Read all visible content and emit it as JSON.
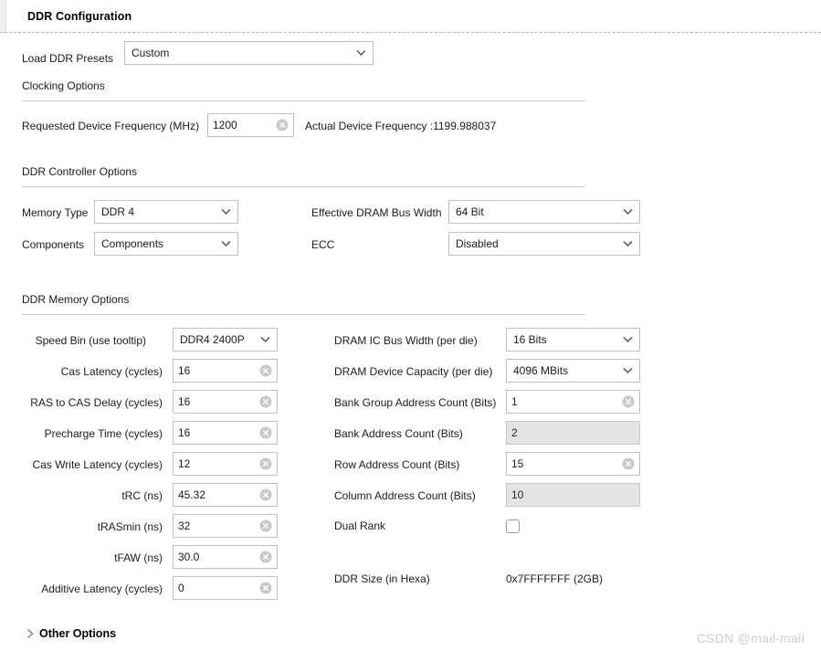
{
  "panel": {
    "title": "DDR Configuration"
  },
  "presets": {
    "label": "Load DDR Presets",
    "value": "Custom"
  },
  "clocking": {
    "section": "Clocking Options",
    "requested_label": "Requested Device Frequency (MHz)",
    "requested_value": "1200",
    "actual_text": "Actual Device Frequency :1199.988037"
  },
  "controller": {
    "section": "DDR Controller Options",
    "memory_type_label": "Memory Type",
    "memory_type_value": "DDR 4",
    "components_label": "Components",
    "components_value": "Components",
    "bus_width_label": "Effective DRAM Bus Width",
    "bus_width_value": "64 Bit",
    "ecc_label": "ECC",
    "ecc_value": "Disabled"
  },
  "memory": {
    "section": "DDR Memory Options",
    "left_rows": [
      {
        "label": "Speed Bin (use tooltip)",
        "value": "DDR4 2400P",
        "kind": "combo"
      },
      {
        "label": "Cas Latency (cycles)",
        "value": "16",
        "kind": "field"
      },
      {
        "label": "RAS to CAS Delay (cycles)",
        "value": "16",
        "kind": "field"
      },
      {
        "label": "Precharge Time (cycles)",
        "value": "16",
        "kind": "field"
      },
      {
        "label": "Cas Write Latency (cycles)",
        "value": "12",
        "kind": "field"
      },
      {
        "label": "tRC (ns)",
        "value": "45.32",
        "kind": "field"
      },
      {
        "label": "tRASmin (ns)",
        "value": "32",
        "kind": "field"
      },
      {
        "label": "tFAW (ns)",
        "value": "30.0",
        "kind": "field"
      },
      {
        "label": "Additive Latency (cycles)",
        "value": "0",
        "kind": "field"
      }
    ],
    "right_rows": [
      {
        "label": "DRAM IC Bus Width (per die)",
        "value": "16 Bits",
        "kind": "combo"
      },
      {
        "label": "DRAM Device Capacity (per die)",
        "value": "4096 MBits",
        "kind": "combo"
      },
      {
        "label": "Bank Group Address Count (Bits)",
        "value": "1",
        "kind": "field"
      },
      {
        "label": "Bank Address Count (Bits)",
        "value": "2",
        "kind": "field-disabled"
      },
      {
        "label": "Row Address Count (Bits)",
        "value": "15",
        "kind": "field"
      },
      {
        "label": "Column Address Count (Bits)",
        "value": "10",
        "kind": "field-disabled"
      }
    ],
    "dual_rank_label": "Dual Rank",
    "dual_rank_checked": false,
    "ddr_size_label": "DDR Size (in Hexa)",
    "ddr_size_value": "0x7FFFFFFF (2GB)"
  },
  "other_options": {
    "label": "Other Options",
    "expanded": false,
    "arrow_icon": "chevron-right-icon"
  },
  "watermark": {
    "text": "CSDN @mail-mail"
  },
  "icons": {
    "clear": "clear-circle-icon",
    "chevron_down": "chevron-down-icon"
  },
  "colors": {
    "field_border": "#c0c0c0",
    "disabled_bg": "#e4e4e4",
    "rule": "#cdcdcd",
    "text": "#1c1c1c"
  }
}
